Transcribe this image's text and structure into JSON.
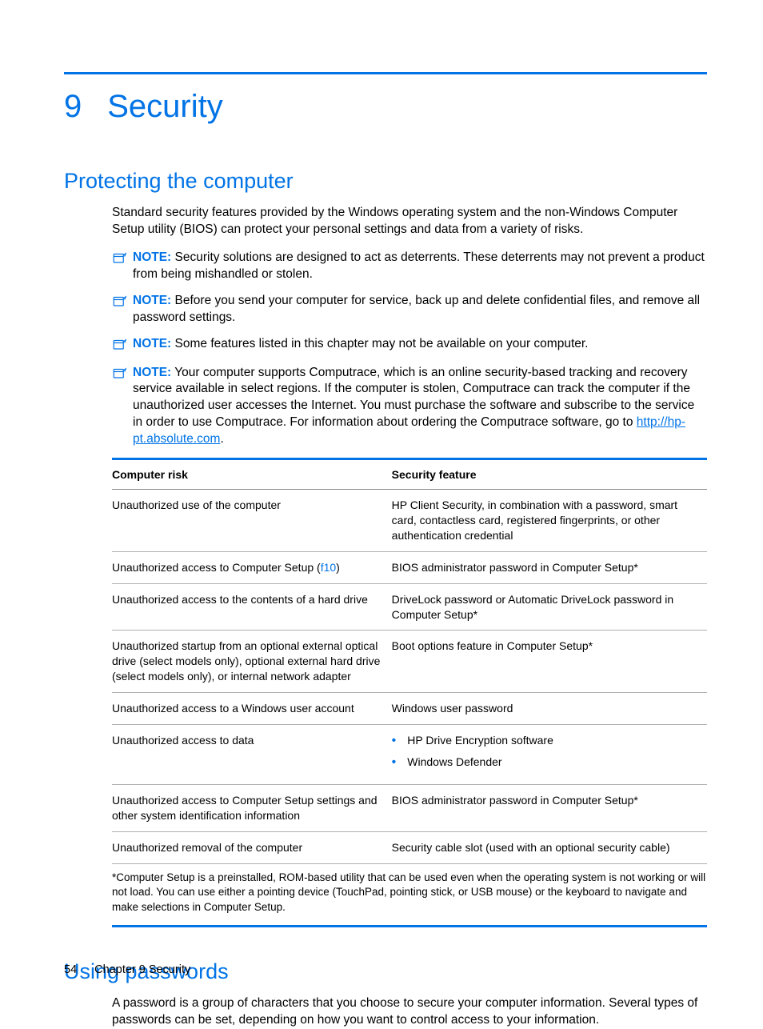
{
  "chapter": {
    "number": "9",
    "title": "Security"
  },
  "section1": {
    "heading": "Protecting the computer",
    "intro": "Standard security features provided by the Windows operating system and the non-Windows Computer Setup utility (BIOS) can protect your personal settings and data from a variety of risks.",
    "notes": [
      {
        "label": "NOTE:",
        "text": "Security solutions are designed to act as deterrents. These deterrents may not prevent a product from being mishandled or stolen."
      },
      {
        "label": "NOTE:",
        "text": "Before you send your computer for service, back up and delete confidential files, and remove all password settings."
      },
      {
        "label": "NOTE:",
        "text": "Some features listed in this chapter may not be available on your computer."
      },
      {
        "label": "NOTE:",
        "text_pre": "Your computer supports Computrace, which is an online security-based tracking and recovery service available in select regions. If the computer is stolen, Computrace can track the computer if the unauthorized user accesses the Internet. You must purchase the software and subscribe to the service in order to use Computrace. For information about ordering the Computrace software, go to ",
        "link": "http://hp-pt.absolute.com",
        "text_post": "."
      }
    ]
  },
  "table": {
    "headers": [
      "Computer risk",
      "Security feature"
    ],
    "rows": [
      {
        "risk": "Unauthorized use of the computer",
        "feature": "HP Client Security, in combination with a password, smart card, contactless card, registered fingerprints, or other authentication credential"
      },
      {
        "risk_pre": "Unauthorized access to Computer Setup (",
        "risk_key": "f10",
        "risk_post": ")",
        "feature": "BIOS administrator password in Computer Setup*"
      },
      {
        "risk": "Unauthorized access to the contents of a hard drive",
        "feature": "DriveLock password or Automatic DriveLock password in Computer Setup*"
      },
      {
        "risk": "Unauthorized startup from an optional external optical drive (select models only), optional external hard drive (select models only), or internal network adapter",
        "feature": "Boot options feature in Computer Setup*"
      },
      {
        "risk": "Unauthorized access to a Windows user account",
        "feature": "Windows user password"
      },
      {
        "risk": "Unauthorized access to data",
        "bullets": [
          "HP Drive Encryption software",
          "Windows Defender"
        ]
      },
      {
        "risk": "Unauthorized access to Computer Setup settings and other system identification information",
        "feature": "BIOS administrator password in Computer Setup*"
      },
      {
        "risk": "Unauthorized removal of the computer",
        "feature": "Security cable slot (used with an optional security cable)"
      }
    ],
    "footnote": "*Computer Setup is a preinstalled, ROM-based utility that can be used even when the operating system is not working or will not load. You can use either a pointing device (TouchPad, pointing stick, or USB mouse) or the keyboard to navigate and make selections in Computer Setup."
  },
  "section2": {
    "heading": "Using passwords",
    "para": "A password is a group of characters that you choose to secure your computer information. Several types of passwords can be set, depending on how you want to control access to your information."
  },
  "footer": {
    "page": "54",
    "crumb": "Chapter 9   Security"
  }
}
